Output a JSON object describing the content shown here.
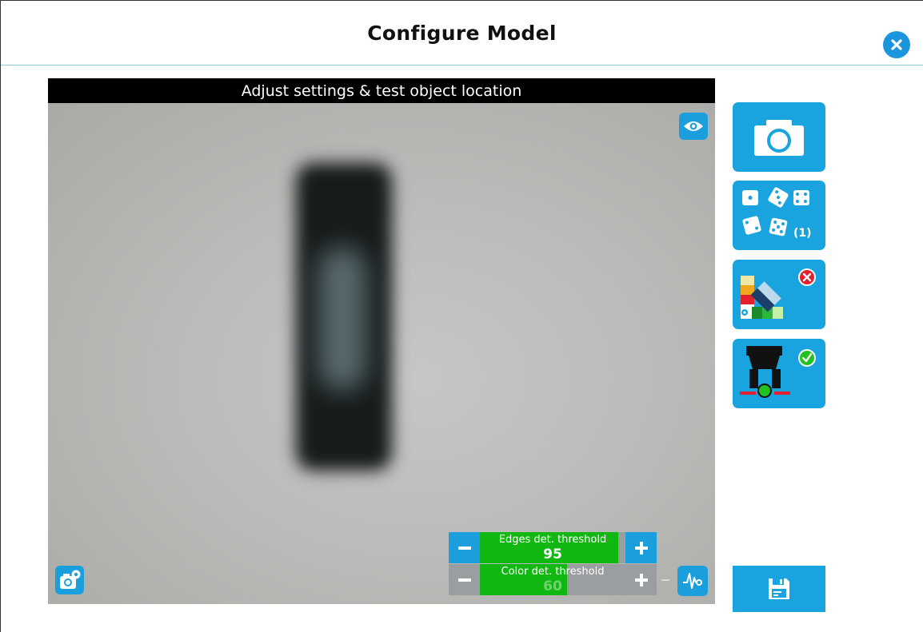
{
  "header": {
    "title": "Configure Model"
  },
  "view": {
    "caption": "Adjust settings & test object location"
  },
  "thresholds": [
    {
      "label": "Edges det. threshold",
      "value": "95",
      "level_percent": 95,
      "active": true
    },
    {
      "label": "Color det. threshold",
      "value": "60",
      "level_percent": 60,
      "active": false
    }
  ],
  "side": {
    "model_count": "(1)"
  },
  "colors": {
    "accent": "#19a4e0",
    "threshold_fill": "#11b811",
    "error": "#e2202e",
    "ok": "#1fc21f"
  },
  "icons": {
    "close": "close-icon",
    "eye": "eye-icon",
    "camera_settings": "camera-settings-icon",
    "snapshot": "camera-icon",
    "multiple_models": "dice-icon",
    "color_palette": "color-palette-icon",
    "gripper": "gripper-icon",
    "filter": "filter-icon",
    "save": "floppy-disk-icon"
  }
}
